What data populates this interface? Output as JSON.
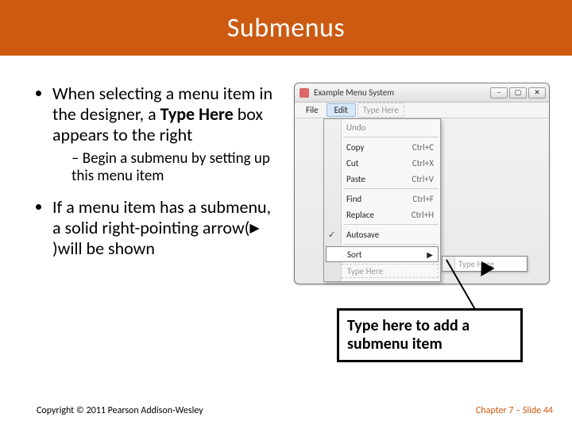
{
  "title": "Submenus",
  "bullets": {
    "b1_pre": "When selecting a menu item in the designer, a ",
    "b1_bold": "Type Here",
    "b1_post": " box appears to the right",
    "b1_sub": "Begin a submenu by setting up this menu item",
    "b2_pre": "If a menu item has a submenu, a solid right-pointing arrow(",
    "b2_arrow": "▶",
    "b2_post": ")will be shown"
  },
  "window": {
    "title": "Example Menu System",
    "file": "File",
    "edit": "Edit",
    "typehere": "Type Here",
    "items": {
      "undo": {
        "label": "Undo",
        "shortcut": ""
      },
      "copy": {
        "label": "Copy",
        "shortcut": "Ctrl+C"
      },
      "cut": {
        "label": "Cut",
        "shortcut": "Ctrl+X"
      },
      "paste": {
        "label": "Paste",
        "shortcut": "Ctrl+V"
      },
      "find": {
        "label": "Find",
        "shortcut": "Ctrl+F"
      },
      "replace": {
        "label": "Replace",
        "shortcut": "Ctrl+H"
      },
      "autosave": {
        "label": "Autosave",
        "shortcut": ""
      },
      "sort": {
        "label": "Sort"
      },
      "typehere": {
        "label": "Type Here"
      }
    },
    "flyout": "Type Here"
  },
  "callout": "Type here to add a submenu item",
  "copyright": "Copyright © 2011 Pearson Addison-Wesley",
  "slide_ref": "Chapter 7 – Slide 44"
}
